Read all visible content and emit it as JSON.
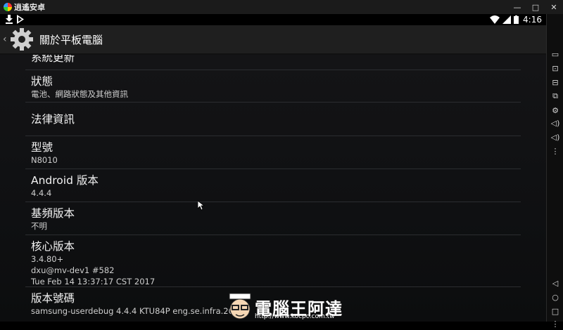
{
  "window": {
    "app_name": "逍遙安卓",
    "controls": [
      "—",
      "□",
      "✕"
    ]
  },
  "statusbar": {
    "time": "4:16"
  },
  "actionbar": {
    "title": "關於平板電腦"
  },
  "items": [
    {
      "title": "系統更新",
      "subtitle": ""
    },
    {
      "title": "狀態",
      "subtitle": "電池、網路狀態及其他資訊"
    },
    {
      "title": "法律資訊",
      "subtitle": ""
    },
    {
      "title": "型號",
      "subtitle": "N8010"
    },
    {
      "title": "Android 版本",
      "subtitle": "4.4.4"
    },
    {
      "title": "基頻版本",
      "subtitle": "不明"
    },
    {
      "title": "核心版本",
      "subtitle": "3.4.80+",
      "subtitle2": "dxu@mv-dev1 #582",
      "subtitle3": "Tue Feb 14 13:37:17 CST 2017"
    },
    {
      "title": "版本號碼",
      "subtitle": "samsung-userdebug 4.4.4 KTU84P eng.se.infra.20170"
    }
  ],
  "watermark": {
    "title": "電腦王阿達",
    "url": "http://www.kocpc.com.tw"
  },
  "icons": [
    "settings-gear-icon",
    "download-icon",
    "play-store-icon",
    "wifi-icon",
    "signal-icon",
    "battery-icon"
  ],
  "colors": {
    "background": "#0f1012",
    "actionbar": "#1f1f1f",
    "divider": "#2b2d30",
    "text": "#f2f2f2"
  }
}
